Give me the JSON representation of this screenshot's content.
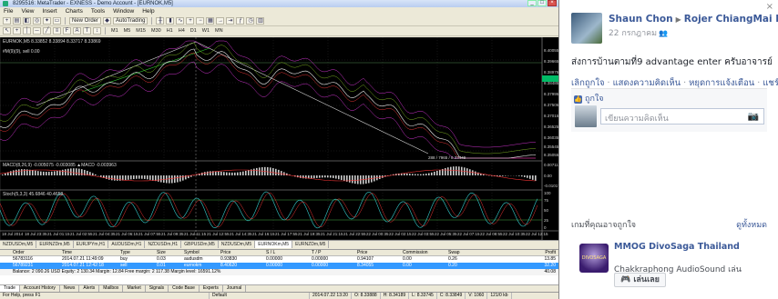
{
  "mt4": {
    "title": "8295516: MetaTrader - EXNESS - Demo Account - [EURNOK,M5]",
    "menu": [
      "File",
      "View",
      "Insert",
      "Charts",
      "Tools",
      "Window",
      "Help"
    ],
    "toolbar": {
      "new_order": "New Order",
      "autotrading": "AutoTrading"
    },
    "timeframes": [
      "M1",
      "M5",
      "M15",
      "M30",
      "H1",
      "H4",
      "D1",
      "W1",
      "MN"
    ],
    "chart_header": "EURNOK,M5  8.33852 8.33894 8.33717 8.33869",
    "ma_label": "#M(9)(9), sell 0.00",
    "macd_label": "MACD(8,26,9) -0.005075 -0.003085 ▲MACD -0.003963",
    "stoch_label": "Stoch(5,3,3) 45.6846 40.4658",
    "price_axis": [
      "8.40055",
      "8.39665",
      "8.38975",
      "8.38485",
      "8.37995",
      "8.37505",
      "8.37015",
      "8.36525",
      "8.36035",
      "8.35545",
      "8.35055"
    ],
    "macd_axis": [
      "0.007115",
      "0.00",
      "-0.01017"
    ],
    "stoch_axis": [
      "100",
      "75",
      "50",
      "25",
      "0"
    ],
    "chart_info": "288 / 7965 / 8.33449",
    "time_axis": [
      "18 Jul 2014",
      "18 Jul 23:35",
      "21 Jul 01:15",
      "21 Jul 02:55",
      "21 Jul 04:35",
      "21 Jul 06:15",
      "21 Jul 07:55",
      "21 Jul 09:35",
      "21 Jul 11:15",
      "21 Jul 12:55",
      "21 Jul 14:35",
      "21 Jul 16:15",
      "21 Jul 17:55",
      "21 Jul 19:35",
      "21 Jul 21:15",
      "21 Jul 22:55",
      "22 Jul 00:35",
      "22 Jul 02:15",
      "22 Jul 03:55",
      "22 Jul 05:35",
      "22 Jul 07:15",
      "22 Jul 08:55",
      "22 Jul 10:35",
      "22 Jul 12:15"
    ],
    "symbol_tabs": [
      "NZDUSDm,M5",
      "EURNZDm,M5",
      "EURJPYm,H1",
      "AUDUSDm,H1",
      "NZDUSDm,H1",
      "GBPUSDm,M5",
      "NZDUSDm,M5",
      "EURNOKm,M5",
      "EURNZDm,M5"
    ],
    "active_symbol_tab": 7,
    "terminal": {
      "columns": [
        "",
        "Order",
        "Time",
        "Type",
        "Size",
        "Symbol",
        "Price",
        "S / L",
        "T / P",
        "Price",
        "Commission",
        "Swap",
        "Profit"
      ],
      "rows": [
        [
          "",
          "56783116",
          "2014.07.21 11:49:09",
          "buy",
          "0.03",
          "audusdm",
          "0.93830",
          "0.00000",
          "0.00000",
          "0.94107",
          "0.00",
          "0.26",
          "13.85"
        ],
        [
          "",
          "56789231",
          "2014.07.21 12:42:18",
          "sell",
          "0.01",
          "eurnokm",
          "8.40620",
          "0.00000",
          "0.00000",
          "8.34055",
          "0.00",
          "0.20",
          "32.20"
        ]
      ],
      "balance": "Balance: 2 090.26 USD  Equity: 2 130.34  Margin: 12.84  Free margin: 2 117.38  Margin level: 16591.12%",
      "balance_total": "40.08",
      "tabs": [
        "Trade",
        "Account History",
        "News",
        "Alerts",
        "Mailbox",
        "Market",
        "Signals",
        "Code Base",
        "Experts",
        "Journal"
      ]
    },
    "status": [
      "For Help, press F1",
      "Default",
      "2014.07.22 13:20",
      "O: 8.33888",
      "H: 8.34189",
      "L: 8.33745",
      "C: 8.33849",
      "V: 1060",
      "121/0 kb"
    ]
  },
  "fb": {
    "author": "Shaun Chon",
    "target": "Rojer ChiangMai FX",
    "date": "22 กรกฎาคม",
    "message": "ส่งการบ้านตามที่9 advantage enter ครับอาจารย์",
    "actions": [
      "เลิกถูกใจ",
      "แสดงความคิดเห็น",
      "หยุดการแจ้งเตือน",
      "แชร์"
    ],
    "liked": "ถูกใจ",
    "comment_placeholder": "เขียนความคิดเห็น",
    "games_title": "เกมที่คุณอาจถูกใจ",
    "see_all": "ดูทั้งหมด",
    "game_name": "MMOG DivoSaga Thailand",
    "game_icon_text": "DIVOSAGA",
    "game_desc": "Chakkraphong AudioSound เล่น",
    "play": "เล่นเลย"
  }
}
